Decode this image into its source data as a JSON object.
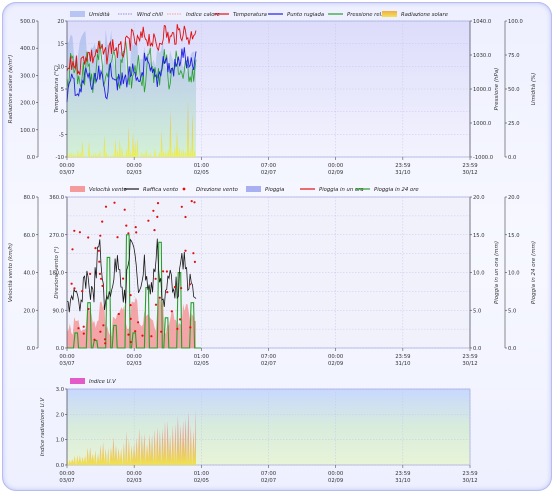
{
  "colors": {
    "rain_fill": "#9aa3ee",
    "wind_fill": "#f48b8b",
    "direction_dot": "#e01010",
    "gust_line": "#1a1a1a",
    "rain_rate_line": "#e01010",
    "rain24_line": "#27a02a",
    "humidity_fill": "#aebdf2",
    "wind_chill": "#9b8bd8",
    "heat_index": "#f5a0a0",
    "temperature": "#e01010",
    "dew_point": "#2020e0",
    "pressure": "#27a02a",
    "solar": "#f0a030",
    "uv_fill": "#e040c0"
  },
  "x_ticks": [
    {
      "time": "00:00",
      "date": "03/07"
    },
    {
      "time": "00:00",
      "date": "02/03"
    },
    {
      "time": "01:00",
      "date": "02/05"
    },
    {
      "time": "07:00",
      "date": "02/07"
    },
    {
      "time": "00:00",
      "date": "02/09"
    },
    {
      "time": "23:59",
      "date": "31/10"
    },
    {
      "time": "23:59",
      "date": "30/12"
    }
  ],
  "chart_data": [
    {
      "type": "line",
      "legend": [
        "Umidità",
        "Wind chill",
        "Indice calore",
        "Temperatura",
        "Punto rugiada",
        "Pressione rel.",
        "Radiazione solare"
      ],
      "axes": {
        "solar": {
          "label": "Radiazione solare (w/m²)",
          "ticks": [
            "0.0",
            "100.0",
            "200.0",
            "300.0",
            "400.0",
            "500.0"
          ],
          "range": [
            0,
            500
          ]
        },
        "temperature": {
          "label": "Temperatura (°C)",
          "ticks": [
            "-10",
            "-5",
            "0",
            "5",
            "10",
            "15",
            "20"
          ],
          "range": [
            -10,
            20
          ]
        },
        "pressure": {
          "label": "Pressione (hPa)",
          "ticks": [
            "-1000.0",
            "1000.0",
            "1000.0",
            "1030.0",
            "1040.0"
          ],
          "range": [
            960,
            1040
          ]
        },
        "humidity": {
          "label": "Umidità (%)",
          "ticks": [
            "0.0",
            "25.0",
            "50.0",
            "75.0",
            "100.0"
          ],
          "range": [
            0,
            100
          ]
        }
      },
      "series": [
        {
          "name": "Temperatura",
          "values": [
            9,
            11,
            10,
            13,
            12,
            14,
            12,
            15,
            13,
            14,
            16,
            15,
            17,
            16,
            14,
            18,
            16,
            17,
            18,
            16,
            19
          ]
        },
        {
          "name": "Punto rugiada",
          "values": [
            4,
            7,
            3,
            9,
            5,
            8,
            4,
            10,
            6,
            7,
            9,
            5,
            11,
            8,
            7,
            12,
            9,
            10,
            13,
            9,
            11
          ]
        },
        {
          "name": "Pressione rel.",
          "values": [
            1005,
            1020,
            998,
            1015,
            1002,
            1025,
            1000,
            1018,
            1004,
            1022,
            1001,
            1016,
            1006,
            1019,
            1003,
            1021,
            1005,
            1017,
            1008,
            1012,
            1010
          ]
        },
        {
          "name": "Umidità",
          "values": [
            85,
            70,
            90,
            75,
            80,
            65,
            88,
            72,
            78,
            60,
            82,
            70,
            76,
            68,
            80,
            64,
            72,
            70,
            66,
            74,
            68
          ]
        }
      ]
    },
    {
      "type": "line",
      "legend": [
        "Velocità vento",
        "Raffica vento",
        "Direzione vento",
        "Pioggia",
        "Pioggia in un ora",
        "Pioggia in 24 ore"
      ],
      "axes": {
        "wind_speed": {
          "label": "Velocità vento (km/h)",
          "ticks": [
            "0.0",
            "20.0",
            "40.0",
            "60.0",
            "80.0"
          ],
          "range": [
            0,
            80
          ]
        },
        "direction": {
          "label": "Direzione vento (°)",
          "ticks": [
            "0.0",
            "90.0",
            "180.0",
            "270.0",
            "360.0"
          ],
          "range": [
            0,
            360
          ]
        },
        "rain_rate": {
          "label": "Pioggia in un ora (mm)",
          "ticks": [
            "0.0",
            "5.0",
            "10.0",
            "15.0",
            "20.0"
          ],
          "range": [
            0,
            20
          ]
        },
        "rain_24h": {
          "label": "Pioggia in 24 ore (mm)",
          "ticks": [
            "0.0",
            "5.0",
            "10.0",
            "15.0",
            "20.0"
          ],
          "range": [
            0,
            20
          ]
        }
      },
      "series": [
        {
          "name": "Velocità vento",
          "values": [
            10,
            14,
            8,
            18,
            12,
            22,
            9,
            16,
            20,
            11,
            26,
            14,
            19,
            12,
            24,
            10,
            17,
            13,
            21,
            15,
            12
          ]
        },
        {
          "name": "Raffica vento",
          "values": [
            22,
            30,
            18,
            40,
            26,
            55,
            20,
            36,
            48,
            24,
            62,
            30,
            44,
            28,
            52,
            22,
            40,
            30,
            46,
            34,
            26
          ]
        },
        {
          "name": "Pioggia in 24 ore",
          "values": [
            0,
            2,
            0,
            6,
            1,
            0,
            12,
            3,
            0,
            15,
            2,
            0,
            8,
            0,
            14,
            4,
            0,
            10,
            0,
            6,
            0
          ]
        }
      ]
    },
    {
      "type": "area",
      "legend": [
        "Indice U.V"
      ],
      "axes": {
        "uv": {
          "label": "Indice radiazione U.V",
          "ticks": [
            "0.0",
            "1.0",
            "2.0",
            "3.0"
          ],
          "range": [
            0,
            3
          ]
        }
      },
      "series": [
        {
          "name": "Indice U.V",
          "values": [
            0.3,
            0.5,
            0.4,
            0.7,
            0.6,
            0.9,
            0.8,
            1.1,
            0.9,
            1.3,
            1.1,
            1.4,
            1.2,
            1.6,
            1.5,
            1.8,
            1.6,
            1.9,
            2.1,
            1.8,
            2.4
          ]
        }
      ]
    }
  ]
}
